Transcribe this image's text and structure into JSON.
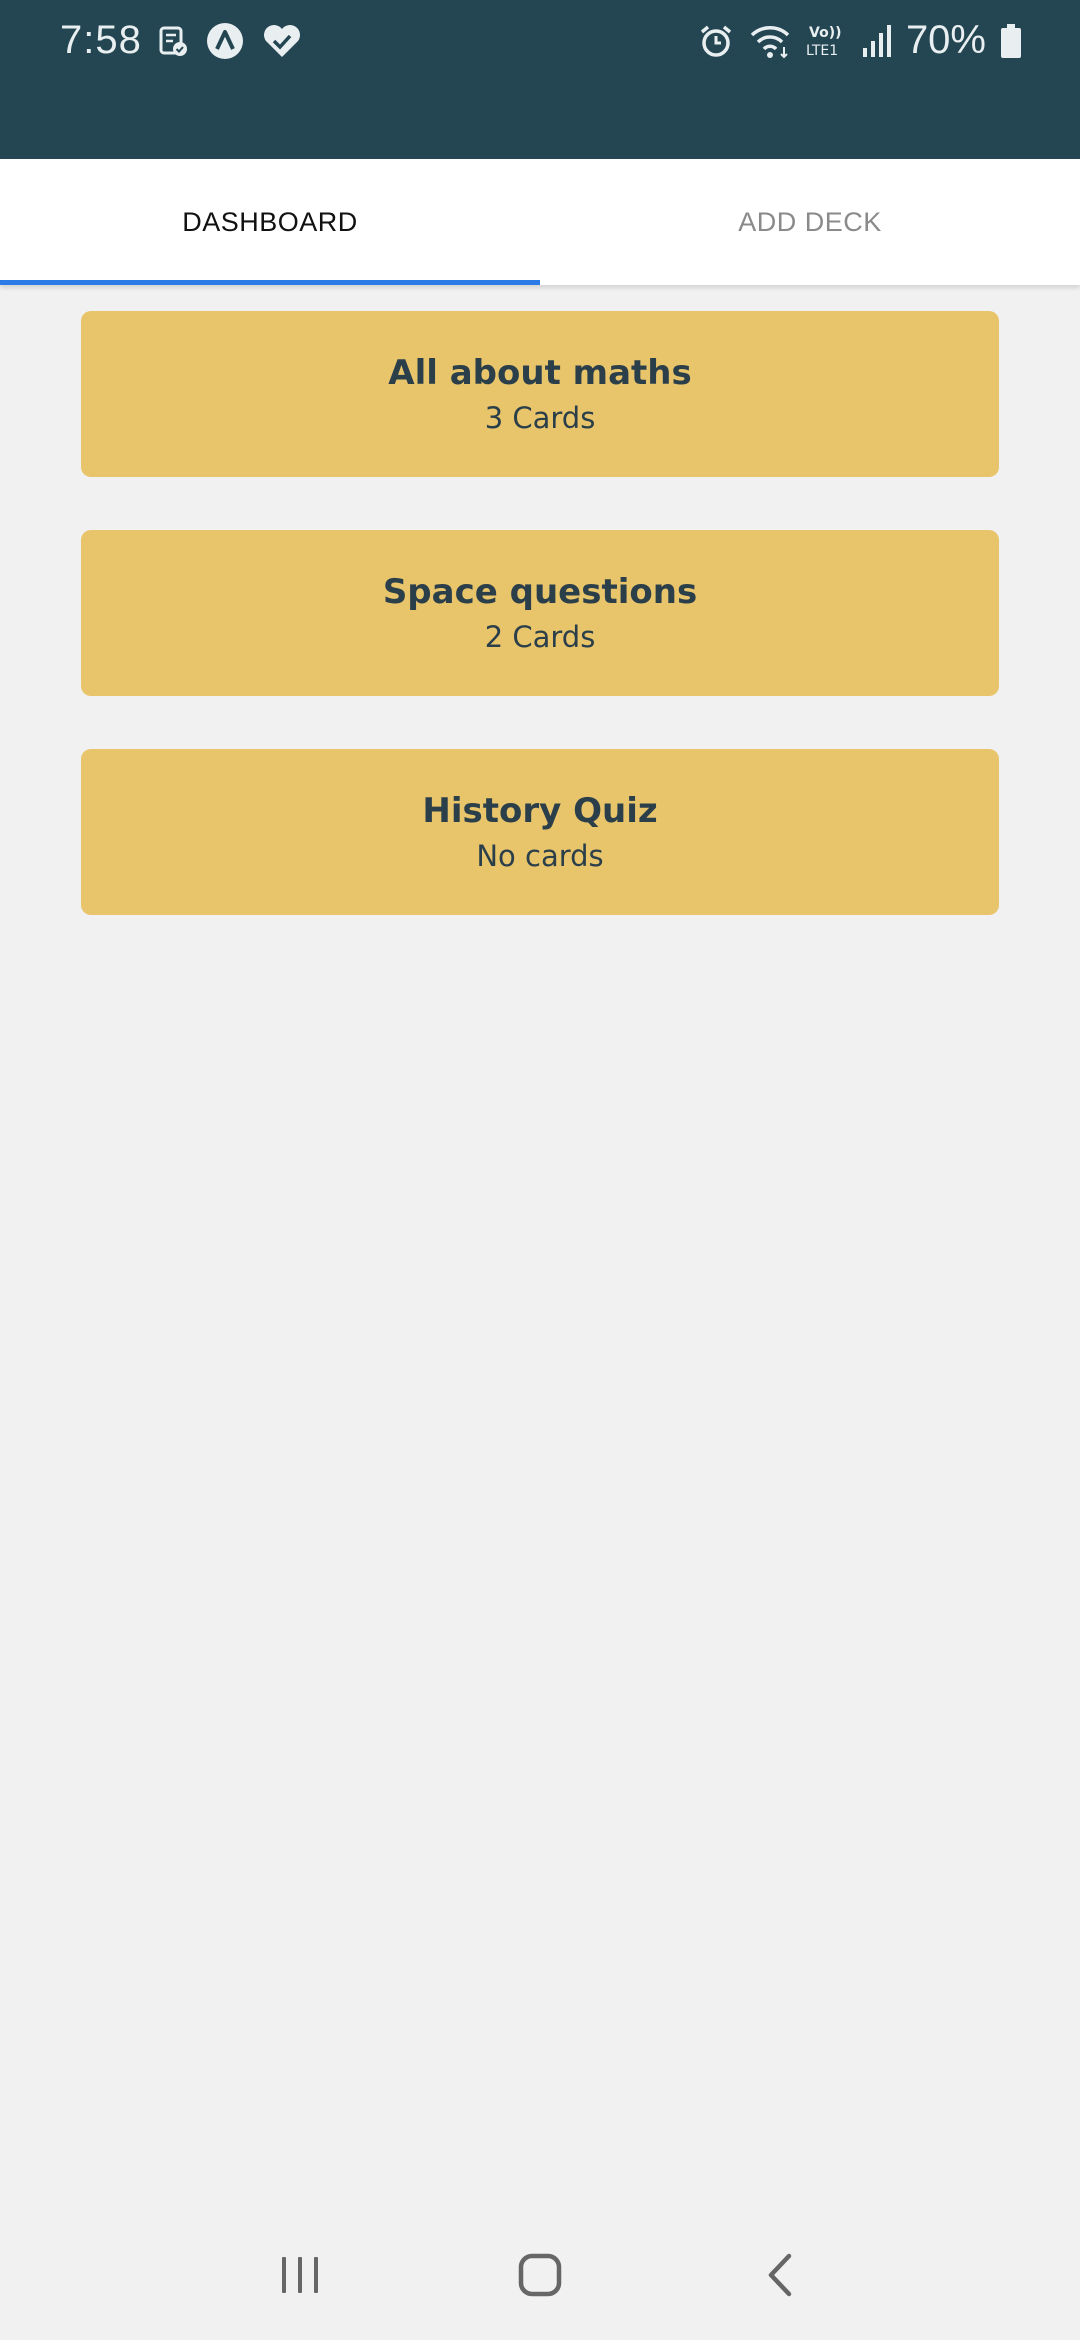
{
  "status_bar": {
    "time": "7:58",
    "battery": "70%",
    "left_icons": [
      "sim-manager-icon",
      "app-a-icon",
      "health-icon"
    ],
    "right_icons": [
      "alarm-icon",
      "wifi-icon",
      "volte-icon",
      "signal-icon",
      "battery-icon"
    ]
  },
  "tabs": [
    {
      "label": "DASHBOARD",
      "active": true
    },
    {
      "label": "ADD DECK",
      "active": false
    }
  ],
  "decks": [
    {
      "title": "All about maths",
      "count": "3 Cards"
    },
    {
      "title": "Space questions",
      "count": "2 Cards"
    },
    {
      "title": "History Quiz",
      "count": "No cards"
    }
  ],
  "nav_bar": {
    "icons": [
      "recent-apps-icon",
      "home-icon",
      "back-icon"
    ]
  },
  "colors": {
    "header_bg": "#244653",
    "card_bg": "#e8c46b",
    "tab_indicator": "#2a7be6",
    "page_bg": "#f1f1f1"
  }
}
